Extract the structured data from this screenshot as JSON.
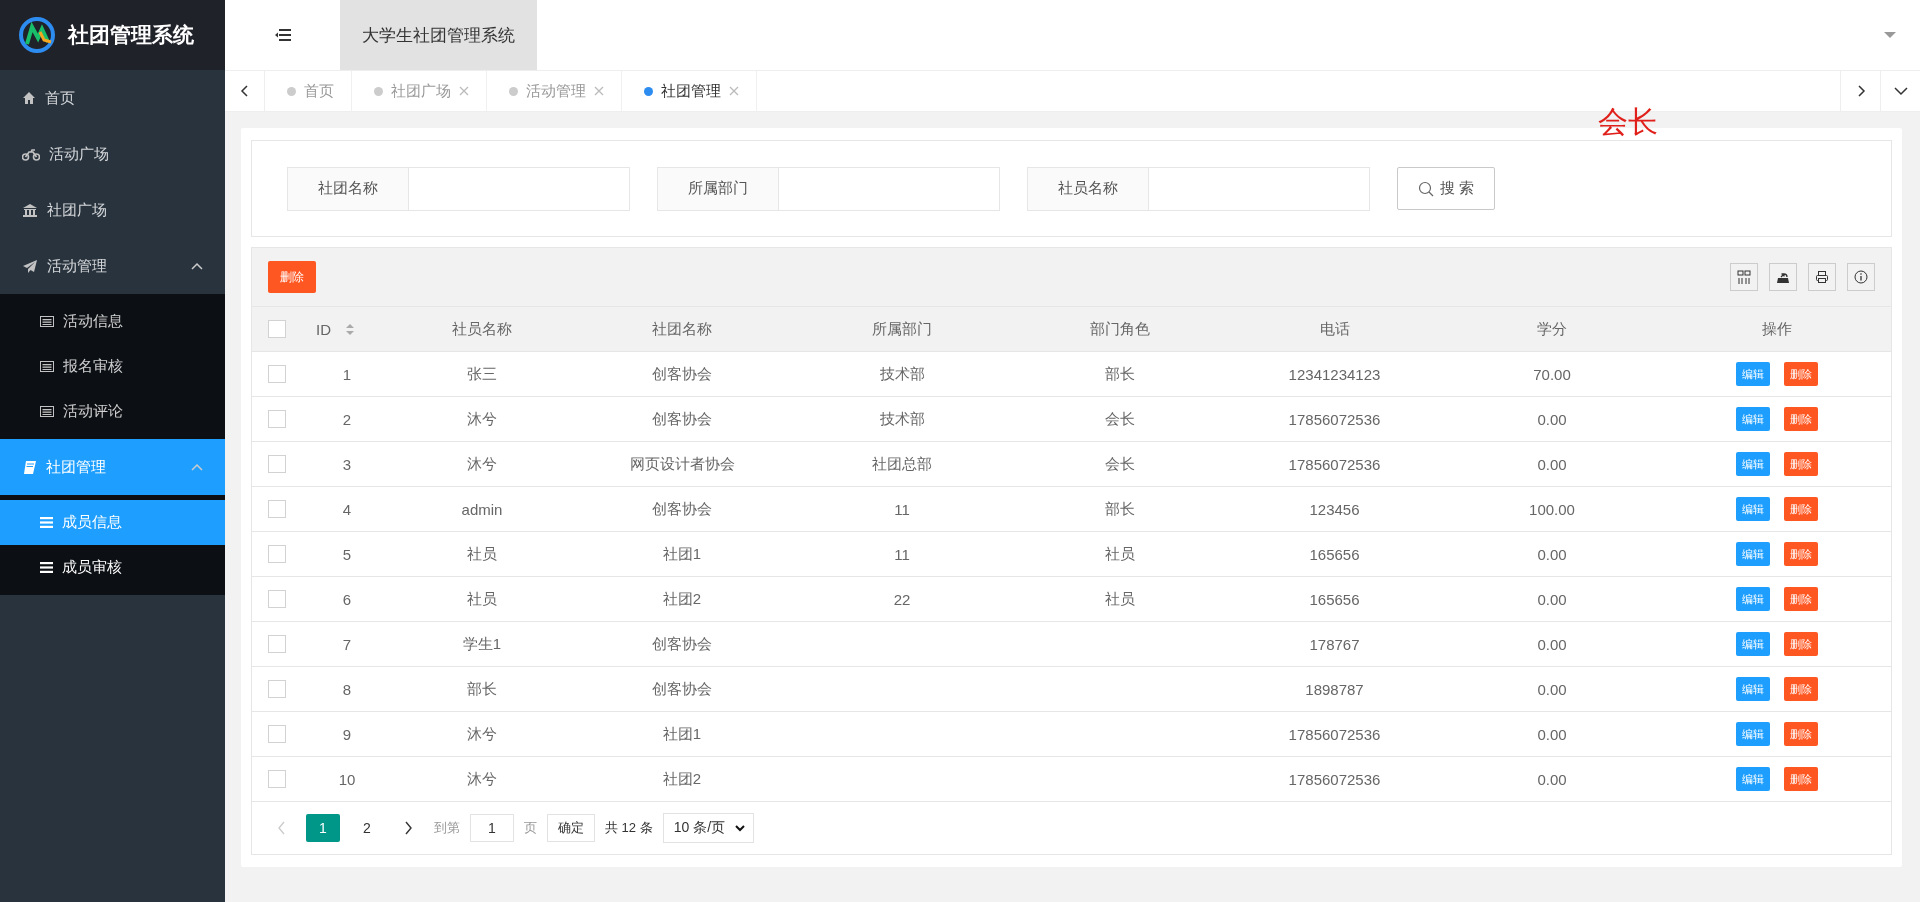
{
  "app": {
    "logo_text": "社团管理系统",
    "title": "大学生社团管理系统"
  },
  "sidebar": {
    "items": [
      {
        "label": "首页",
        "selected": false
      },
      {
        "label": "活动广场",
        "selected": false
      },
      {
        "label": "社团广场",
        "selected": false
      },
      {
        "label": "活动管理",
        "selected": false,
        "expanded": true,
        "children": [
          {
            "label": "活动信息",
            "selected": false
          },
          {
            "label": "报名审核",
            "selected": false
          },
          {
            "label": "活动评论",
            "selected": false
          }
        ]
      },
      {
        "label": "社团管理",
        "selected": true,
        "expanded": true,
        "children": [
          {
            "label": "成员信息",
            "selected": true
          },
          {
            "label": "成员审核",
            "selected": false
          }
        ]
      }
    ]
  },
  "tabs": [
    {
      "label": "首页",
      "selected": false,
      "closable": false
    },
    {
      "label": "社团广场",
      "selected": false,
      "closable": true
    },
    {
      "label": "活动管理",
      "selected": false,
      "closable": true
    },
    {
      "label": "社团管理",
      "selected": true,
      "closable": true
    }
  ],
  "annotation": "会长",
  "search": {
    "fields": [
      {
        "label": "社团名称"
      },
      {
        "label": "所属部门"
      },
      {
        "label": "社员名称"
      }
    ],
    "button": "搜 索"
  },
  "table": {
    "toolbar_button": "删除",
    "select_all_checked": false,
    "columns": [
      {
        "label": "ID",
        "sortable": true
      },
      {
        "label": "社员名称",
        "sortable": false
      },
      {
        "label": "社团名称",
        "sortable": false
      },
      {
        "label": "所属部门",
        "sortable": false
      },
      {
        "label": "部门角色",
        "sortable": false
      },
      {
        "label": "电话",
        "sortable": false
      },
      {
        "label": "学分",
        "sortable": false
      },
      {
        "label": "操作",
        "sortable": false
      }
    ],
    "rows": [
      {
        "checked": false,
        "cells": [
          "1",
          "张三",
          "创客协会",
          "技术部",
          "部长",
          "12341234123",
          "70.00"
        ],
        "actions": [
          "编辑",
          "删除"
        ]
      },
      {
        "checked": false,
        "cells": [
          "2",
          "沐兮",
          "创客协会",
          "技术部",
          "会长",
          "17856072536",
          "0.00"
        ],
        "actions": [
          "编辑",
          "删除"
        ]
      },
      {
        "checked": false,
        "cells": [
          "3",
          "沐兮",
          "网页设计者协会",
          "社团总部",
          "会长",
          "17856072536",
          "0.00"
        ],
        "actions": [
          "编辑",
          "删除"
        ]
      },
      {
        "checked": false,
        "cells": [
          "4",
          "admin",
          "创客协会",
          "11",
          "部长",
          "123456",
          "100.00"
        ],
        "actions": [
          "编辑",
          "删除"
        ]
      },
      {
        "checked": false,
        "cells": [
          "5",
          "社员",
          "社团1",
          "11",
          "社员",
          "165656",
          "0.00"
        ],
        "actions": [
          "编辑",
          "删除"
        ]
      },
      {
        "checked": false,
        "cells": [
          "6",
          "社员",
          "社团2",
          "22",
          "社员",
          "165656",
          "0.00"
        ],
        "actions": [
          "编辑",
          "删除"
        ]
      },
      {
        "checked": false,
        "cells": [
          "7",
          "学生1",
          "创客协会",
          "",
          "",
          "178767",
          "0.00"
        ],
        "actions": [
          "编辑",
          "删除"
        ]
      },
      {
        "checked": false,
        "cells": [
          "8",
          "部长",
          "创客协会",
          "",
          "",
          "1898787",
          "0.00"
        ],
        "actions": [
          "编辑",
          "删除"
        ]
      },
      {
        "checked": false,
        "cells": [
          "9",
          "沐兮",
          "社团1",
          "",
          "",
          "17856072536",
          "0.00"
        ],
        "actions": [
          "编辑",
          "删除"
        ]
      },
      {
        "checked": false,
        "cells": [
          "10",
          "沐兮",
          "社团2",
          "",
          "",
          "17856072536",
          "0.00"
        ],
        "actions": [
          "编辑",
          "删除"
        ]
      }
    ]
  },
  "pager": {
    "pages": [
      {
        "label": "1",
        "selected": true
      },
      {
        "label": "2",
        "selected": false
      }
    ],
    "goto_label": "到第",
    "goto_value": "1",
    "page_label": "页",
    "confirm": "确定",
    "total": "共 12 条",
    "page_size": "10 条/页"
  }
}
